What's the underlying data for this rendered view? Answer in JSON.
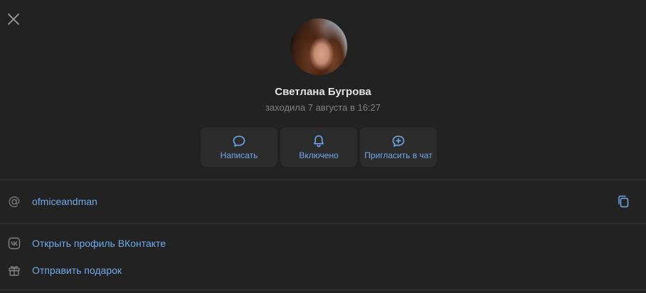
{
  "profile": {
    "name": "Светлана Бугрова",
    "last_seen": "заходила 7 августа в 16:27"
  },
  "actions": [
    {
      "label": "Написать",
      "icon": "message-icon"
    },
    {
      "label": "Включено",
      "icon": "bell-icon"
    },
    {
      "label": "Пригласить в чат",
      "icon": "chat-plus-icon"
    }
  ],
  "info": {
    "username": "ofmiceandman"
  },
  "links": [
    {
      "label": "Открыть профиль ВКонтакте",
      "icon": "vk-icon"
    },
    {
      "label": "Отправить подарок",
      "icon": "gift-icon"
    }
  ],
  "colors": {
    "background": "#222222",
    "surface": "#2c2c2c",
    "accent": "#71aaeb",
    "muted": "#828282",
    "text": "#e1e3e6"
  }
}
